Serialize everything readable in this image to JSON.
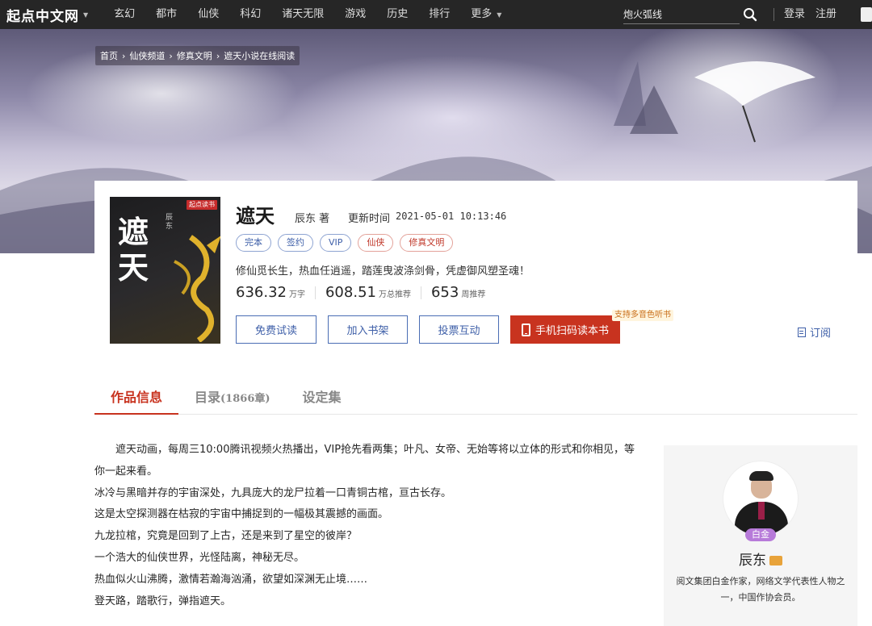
{
  "nav": {
    "logo": "起点中文网",
    "items": [
      "玄幻",
      "都市",
      "仙侠",
      "科幻",
      "诸天无限",
      "游戏",
      "历史",
      "排行"
    ],
    "more": "更多",
    "search_value": "炮火弧线",
    "login": "登录",
    "register": "注册"
  },
  "breadcrumb": [
    "首页",
    "仙侠频道",
    "修真文明",
    "遮天小说在线阅读"
  ],
  "book": {
    "cover_title": "遮天",
    "cover_author": "辰东",
    "cover_badge": "起点读书",
    "title": "遮天",
    "author": "辰东 著",
    "update_label": "更新时间",
    "update_time": "2021-05-01 10:13:46",
    "tags": [
      {
        "label": "完本",
        "style": "blue"
      },
      {
        "label": "签约",
        "style": "blue"
      },
      {
        "label": "VIP",
        "style": "blue"
      },
      {
        "label": "仙侠",
        "style": "red"
      },
      {
        "label": "修真文明",
        "style": "red"
      }
    ],
    "intro": "修仙觅长生，热血任逍遥，踏莲曳波涤剑骨，凭虚御风塑圣魂！",
    "stats": [
      {
        "value": "636.32",
        "unit": "万字"
      },
      {
        "value": "608.51",
        "unit": "万总推荐"
      },
      {
        "value": "653",
        "unit": "周推荐"
      }
    ]
  },
  "actions": {
    "trial": "免费试读",
    "shelf": "加入书架",
    "vote": "投票互动",
    "mobile": "手机扫码读本书",
    "audio_badge": "支持多音色听书",
    "subscribe": "订阅"
  },
  "tabs": {
    "info": "作品信息",
    "catalog": "目录",
    "catalog_count": "(1866章)",
    "settings": "设定集"
  },
  "description": [
    "遮天动画，每周三10:00腾讯视频火热播出，VIP抢先看两集；叶凡、女帝、无始等将以立体的形式和你相见，等你一起来看。",
    "冰冷与黑暗并存的宇宙深处，九具庞大的龙尸拉着一口青铜古棺，亘古长存。",
    "这是太空探测器在枯寂的宇宙中捕捉到的一幅极其震撼的画面。",
    "九龙拉棺，究竟是回到了上古，还是来到了星空的彼岸？",
    "一个浩大的仙侠世界，光怪陆离，神秘无尽。",
    "热血似火山沸腾，激情若瀚海汹涌，欲望如深渊无止境……",
    "登天路，踏歌行，弹指遮天。"
  ],
  "author_panel": {
    "level": "白金",
    "name": "辰东",
    "bio": "阅文集团白金作家，网络文学代表性人物之一，中国作协会员。"
  }
}
